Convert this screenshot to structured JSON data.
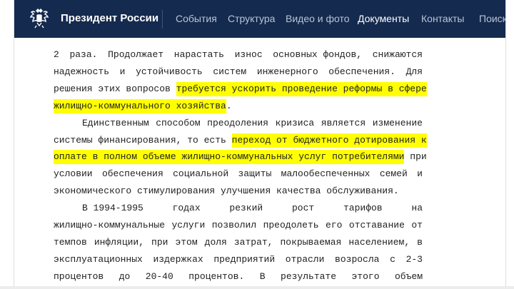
{
  "header": {
    "site_title": "Президент России",
    "nav": [
      "События",
      "Структура",
      "Видео и фото",
      "Документы",
      "Контакты",
      "Поиск"
    ],
    "active": "Документы",
    "bg_color": "#142a4e"
  },
  "document": {
    "lines": [
      {
        "words": [
          "2",
          "раза.",
          "Продолжает",
          "нарастать",
          "износ",
          "основных фондов,",
          "снижаются"
        ]
      },
      {
        "words": [
          "надежность",
          "и",
          "устойчивость",
          "систем",
          "инженерного",
          "обеспечения.",
          "Для"
        ]
      },
      {
        "prefix": "решения этих вопросов ",
        "highlight": "требуется ускорить проведение реформы в сфере"
      },
      {
        "highlight": "жилищно-коммунального хозяйства",
        "suffix": "."
      },
      {
        "indent": true,
        "words": [
          "Единственным",
          "способом",
          "преодоления",
          "кризиса",
          "является",
          "изменение"
        ]
      },
      {
        "prefix": "системы финансирования, то есть ",
        "highlight": "переход от бюджетного дотирования к"
      },
      {
        "highlight": "оплате в полном объеме жилищно-коммунальных услуг потребителями",
        "suffix": " при"
      },
      {
        "words": [
          "условии",
          "обеспечения",
          "социальной",
          "защиты",
          "малообеспеченных",
          "семей",
          "и"
        ]
      },
      {
        "last": true,
        "text": "экономического стимулирования улучшения качества обслуживания."
      },
      {
        "indent": true,
        "words": [
          "В 1994-1995",
          "годах",
          "резкий",
          "рост",
          "тарифов",
          "на"
        ]
      },
      {
        "words": [
          "жилищно-коммунальные",
          "услуги",
          "позволил",
          "преодолеть",
          "его",
          "отставание",
          "от"
        ]
      },
      {
        "words": [
          "темпов",
          "инфляции,",
          "при",
          "этом",
          "доля",
          "затрат,",
          "покрываемая",
          "населением,",
          "в"
        ]
      },
      {
        "words": [
          "эксплуатационных",
          "издержках",
          "предприятий",
          "отрасли",
          "возросла",
          "с",
          "2-3"
        ]
      },
      {
        "words": [
          "процентов",
          "до",
          "20-40",
          "процентов.",
          "В",
          "результате",
          "этого",
          "объем"
        ]
      }
    ],
    "highlight_color": "#ffff00"
  }
}
